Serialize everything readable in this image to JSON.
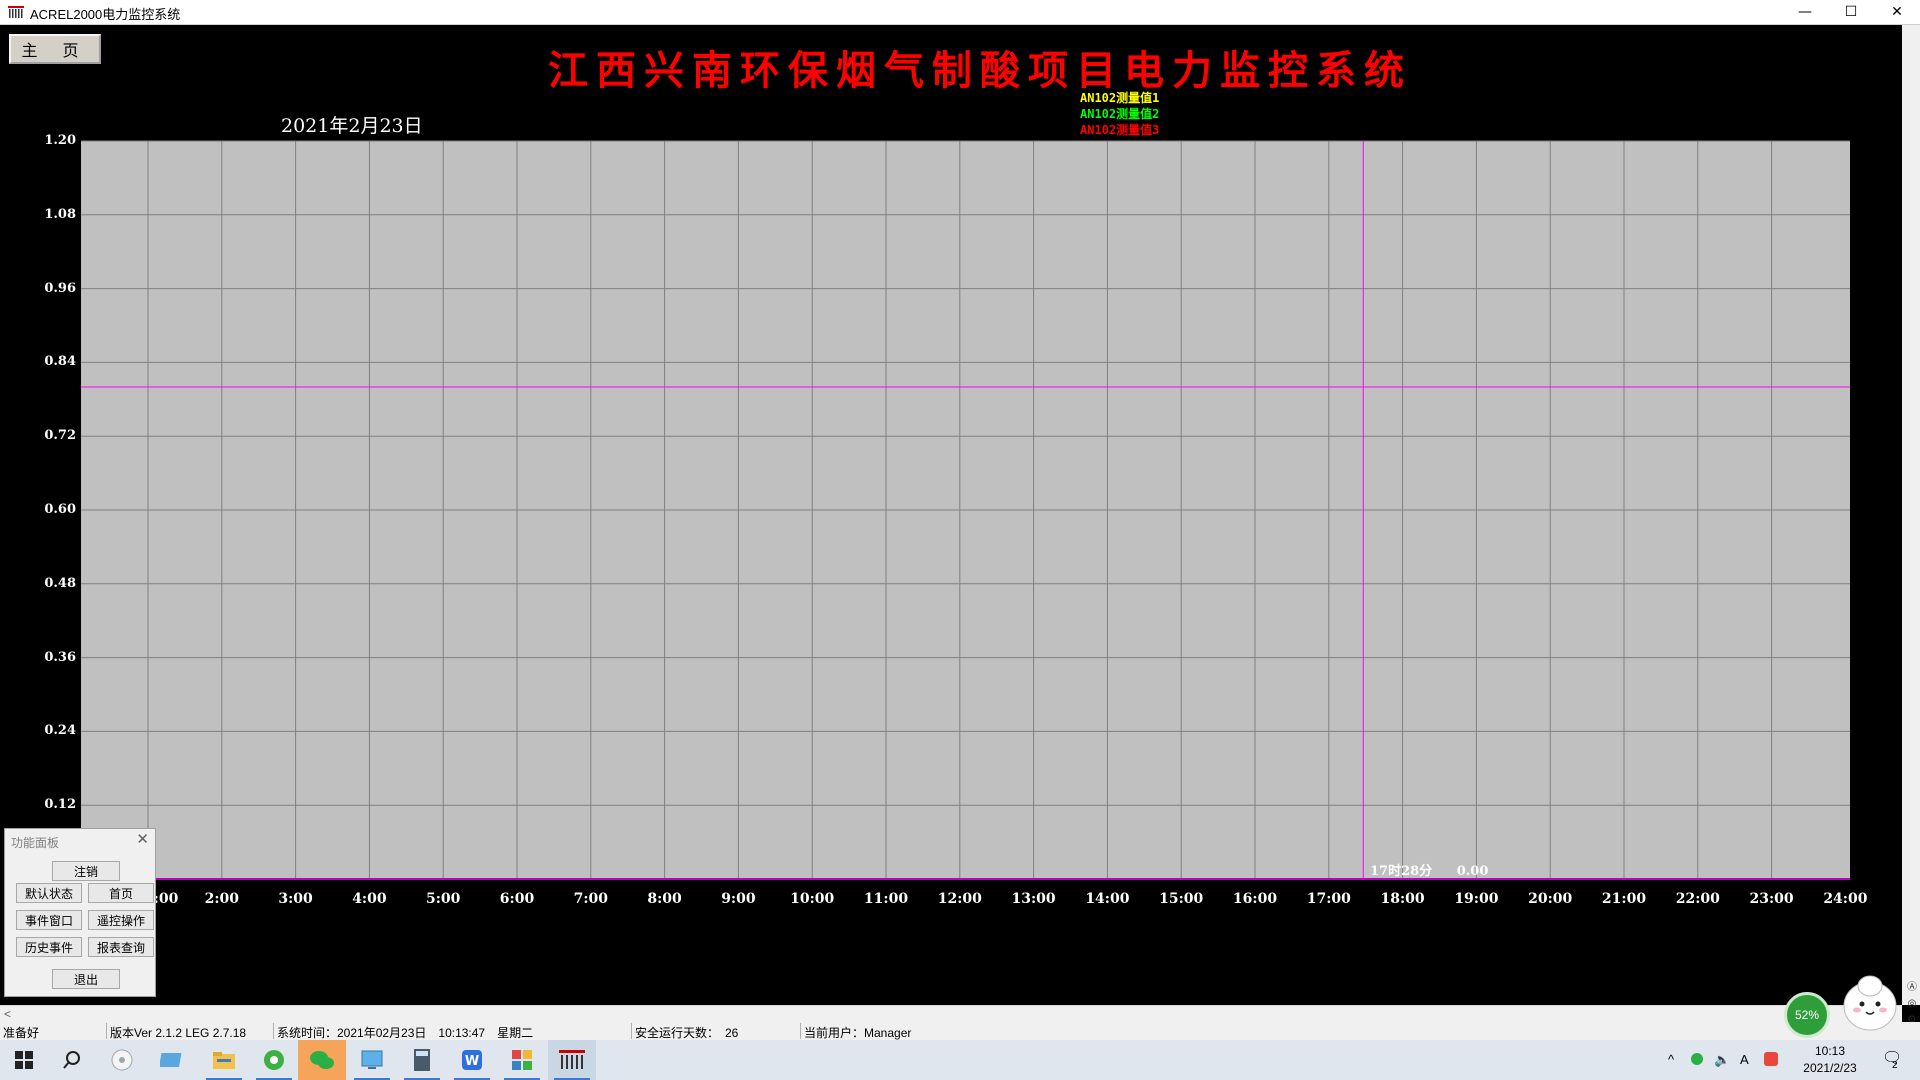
{
  "window": {
    "title": "ACREL2000电力监控系统",
    "minimize_glyph": "—",
    "maximize_glyph": "☐",
    "close_glyph": "✕"
  },
  "toolbar": {
    "home_label": "主 页"
  },
  "header": {
    "title": "江西兴南环保烟气制酸项目电力监控系统",
    "date": "2021年2月23日"
  },
  "chart_data": {
    "type": "line",
    "x_ticks": [
      ":00",
      "2:00",
      "3:00",
      "4:00",
      "5:00",
      "6:00",
      "7:00",
      "8:00",
      "9:00",
      "10:00",
      "11:00",
      "12:00",
      "13:00",
      "14:00",
      "15:00",
      "16:00",
      "17:00",
      "18:00",
      "19:00",
      "20:00",
      "21:00",
      "22:00",
      "23:00",
      "24:00"
    ],
    "y_ticks": [
      "1.20",
      "1.08",
      "0.96",
      "0.84",
      "0.72",
      "0.60",
      "0.48",
      "0.36",
      "0.24",
      "0.12"
    ],
    "ylim": [
      0,
      1.2
    ],
    "xlim_hours": [
      0,
      24
    ],
    "reference_line": {
      "y": 0.8,
      "color": "#ff00ff"
    },
    "cursor": {
      "time_hours": 17.467,
      "label": "17时28分",
      "value": "0.00",
      "color": "#ff00ff"
    },
    "series": [
      {
        "name": "AN102测量值1",
        "color": "#ffff00",
        "values": []
      },
      {
        "name": "AN102测量值2",
        "color": "#00ff00",
        "values": []
      },
      {
        "name": "AN102测量值3",
        "color": "#ff0000",
        "values": []
      }
    ],
    "plot_background": "#c0c0c0",
    "grid": true
  },
  "panel": {
    "title": "功能面板",
    "close_glyph": "✕",
    "buttons": {
      "logout": "注销",
      "default_state": "默认状态",
      "homepage": "首页",
      "event_window": "事件窗口",
      "remote_op": "遥控操作",
      "history_events": "历史事件",
      "report_query": "报表查询",
      "exit": "退出"
    }
  },
  "statusbar": {
    "ready": "准备好",
    "version": "版本Ver 2.1.2 LEG 2.7.18",
    "system_time": "系统时间：2021年02月23日　10:13:47　星期二",
    "safe_days": "安全运行天数：　26",
    "current_user": "当前用户：Manager"
  },
  "taskbar": {
    "clock_time": "10:13",
    "clock_date": "2021/2/23",
    "badge_percent": "52%",
    "notification_count": "2",
    "tray_ime": "A",
    "tray_caret": "^"
  },
  "colors": {
    "title_red": "#ff0000",
    "grid_line": "#808080",
    "taskbar_active": "#f5a45a"
  }
}
